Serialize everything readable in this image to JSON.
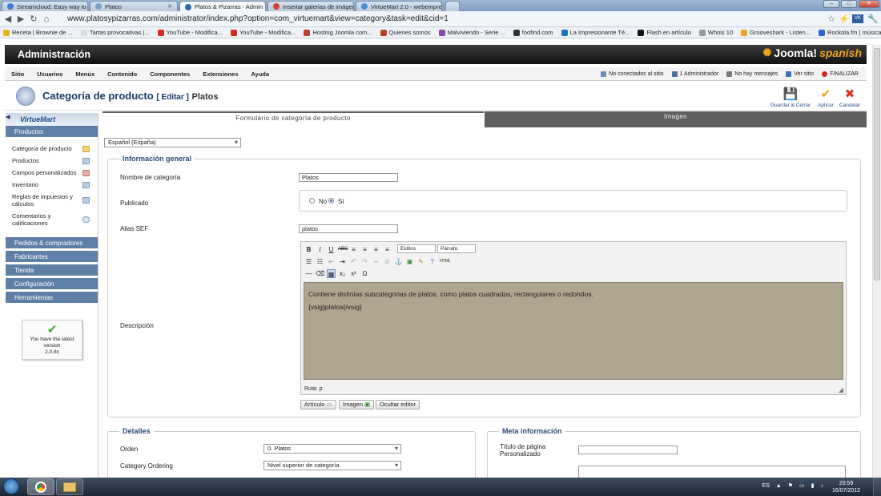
{
  "browser": {
    "tabs": [
      {
        "label": "Streamcloud: Easy way to",
        "color": "#3b7dd8",
        "active": false
      },
      {
        "label": "Platos",
        "color": "#7aa0c9",
        "active": false
      },
      {
        "label": "Platos & Pizarras - Admin",
        "color": "#2f6db3",
        "active": true
      },
      {
        "label": "Insertar galerias de imágen",
        "color": "#d14836",
        "active": false
      },
      {
        "label": "VirtueMart 2.0 - webempre",
        "color": "#4a8fd6",
        "active": false
      }
    ],
    "url": "www.platosypizarras.com/administrator/index.php?option=com_virtuemart&view=category&task=edit&cid=1",
    "bookmarks": [
      {
        "label": "Receta | Brownie de ...",
        "color": "#e8b21d"
      },
      {
        "label": "Tartas provocativas |...",
        "color": "#dddddd"
      },
      {
        "label": "YouTube - Modifica...",
        "color": "#d12b1f"
      },
      {
        "label": "YouTube - Modifica...",
        "color": "#d12b1f"
      },
      {
        "label": "Hosting Joomla com...",
        "color": "#c0392b"
      },
      {
        "label": "Quienes somos",
        "color": "#b5431f"
      },
      {
        "label": "Malviviendo - Serie ...",
        "color": "#8e44ad"
      },
      {
        "label": "foofind.com",
        "color": "#333333"
      },
      {
        "label": "La Impresionante Té...",
        "color": "#1f6fb5"
      },
      {
        "label": "Flash en artículo",
        "color": "#111111"
      },
      {
        "label": "Whois 10",
        "color": "#999999"
      },
      {
        "label": "Grooveshark - Listen...",
        "color": "#f1a22a"
      },
      {
        "label": "Rockola.fm | música...",
        "color": "#2a64c5"
      }
    ]
  },
  "admin": {
    "title": "Administración",
    "logo": "Joomla!",
    "logo_suffix": "spanish",
    "menu": [
      "Sitio",
      "Usuarios",
      "Menús",
      "Contenido",
      "Componentes",
      "Extensiones",
      "Ayuda"
    ],
    "status": [
      {
        "label": "No conectados al sitio",
        "color": "#6b8fbf"
      },
      {
        "label": "1 Administrador",
        "color": "#4a6fa3"
      },
      {
        "label": "No hay mensajes",
        "color": "#7a7a7a"
      },
      {
        "label": "Ver sitio",
        "color": "#3b73b9"
      },
      {
        "label": "FINALIZAR",
        "color": "#cc2b1b"
      }
    ]
  },
  "page": {
    "title": "Categoría de producto",
    "edit_tag": "[ Editar ]",
    "subject": "Platos",
    "toolbar": [
      {
        "label": "Guardar & Cerrar",
        "icon": "save-icon",
        "glyph": "💾"
      },
      {
        "label": "Aplicar",
        "icon": "check-icon",
        "glyph": "✔"
      },
      {
        "label": "Cancelar",
        "icon": "cancel-icon",
        "glyph": "✖"
      }
    ]
  },
  "sidebar": {
    "logo": "VirtueMart",
    "section_products": "Productos",
    "items": [
      "Categoría de producto",
      "Productos",
      "Campos personalizados",
      "Inventario",
      "Reglas de impuestos y cálculos",
      "Comentarios y calificaciones"
    ],
    "sections": [
      "Pedidos & compradores",
      "Fabricantes",
      "Tienda",
      "Configuración",
      "Herramientas"
    ],
    "version_msg": "You have the latest version",
    "version": "2.0.8c"
  },
  "tabs": [
    "Formulario de categoría de producto",
    "Imagen"
  ],
  "language": "Español (España)",
  "general": {
    "legend": "Información general",
    "name_label": "Nombre de categoría",
    "name_value": "Platos",
    "published_label": "Publicado",
    "no": "No",
    "yes": "Sí",
    "alias_label": "Alias SEF",
    "alias_value": "platos",
    "description_label": "Descripción",
    "styles_select": "Estilos",
    "format_select": "Párrafo",
    "description_line1": "Contiene distintas subcategorias de platos, como platos cuadrados, rectangulares o redondos.",
    "description_line2": "{vsig}platos{/vsig}",
    "path": "Ruta: p",
    "btn_article": "Artículo",
    "btn_image": "Imagen",
    "btn_hide": "Ocultar editor"
  },
  "details": {
    "legend": "Detalles",
    "order_label": "Orden",
    "order_value": "0. Platos",
    "ordering_label": "Category Ordering",
    "ordering_value": "Nivel superior de categoría"
  },
  "meta": {
    "legend": "Meta información",
    "page_title_label": "Título de página Personalizado"
  },
  "taskbar": {
    "lang": "ES",
    "time": "20:59",
    "date": "16/07/2012"
  },
  "colors": {
    "editor_bg": "#b0a591",
    "tab_active": "#5f5f5f",
    "sidebar_header": "#5e7fa6"
  }
}
